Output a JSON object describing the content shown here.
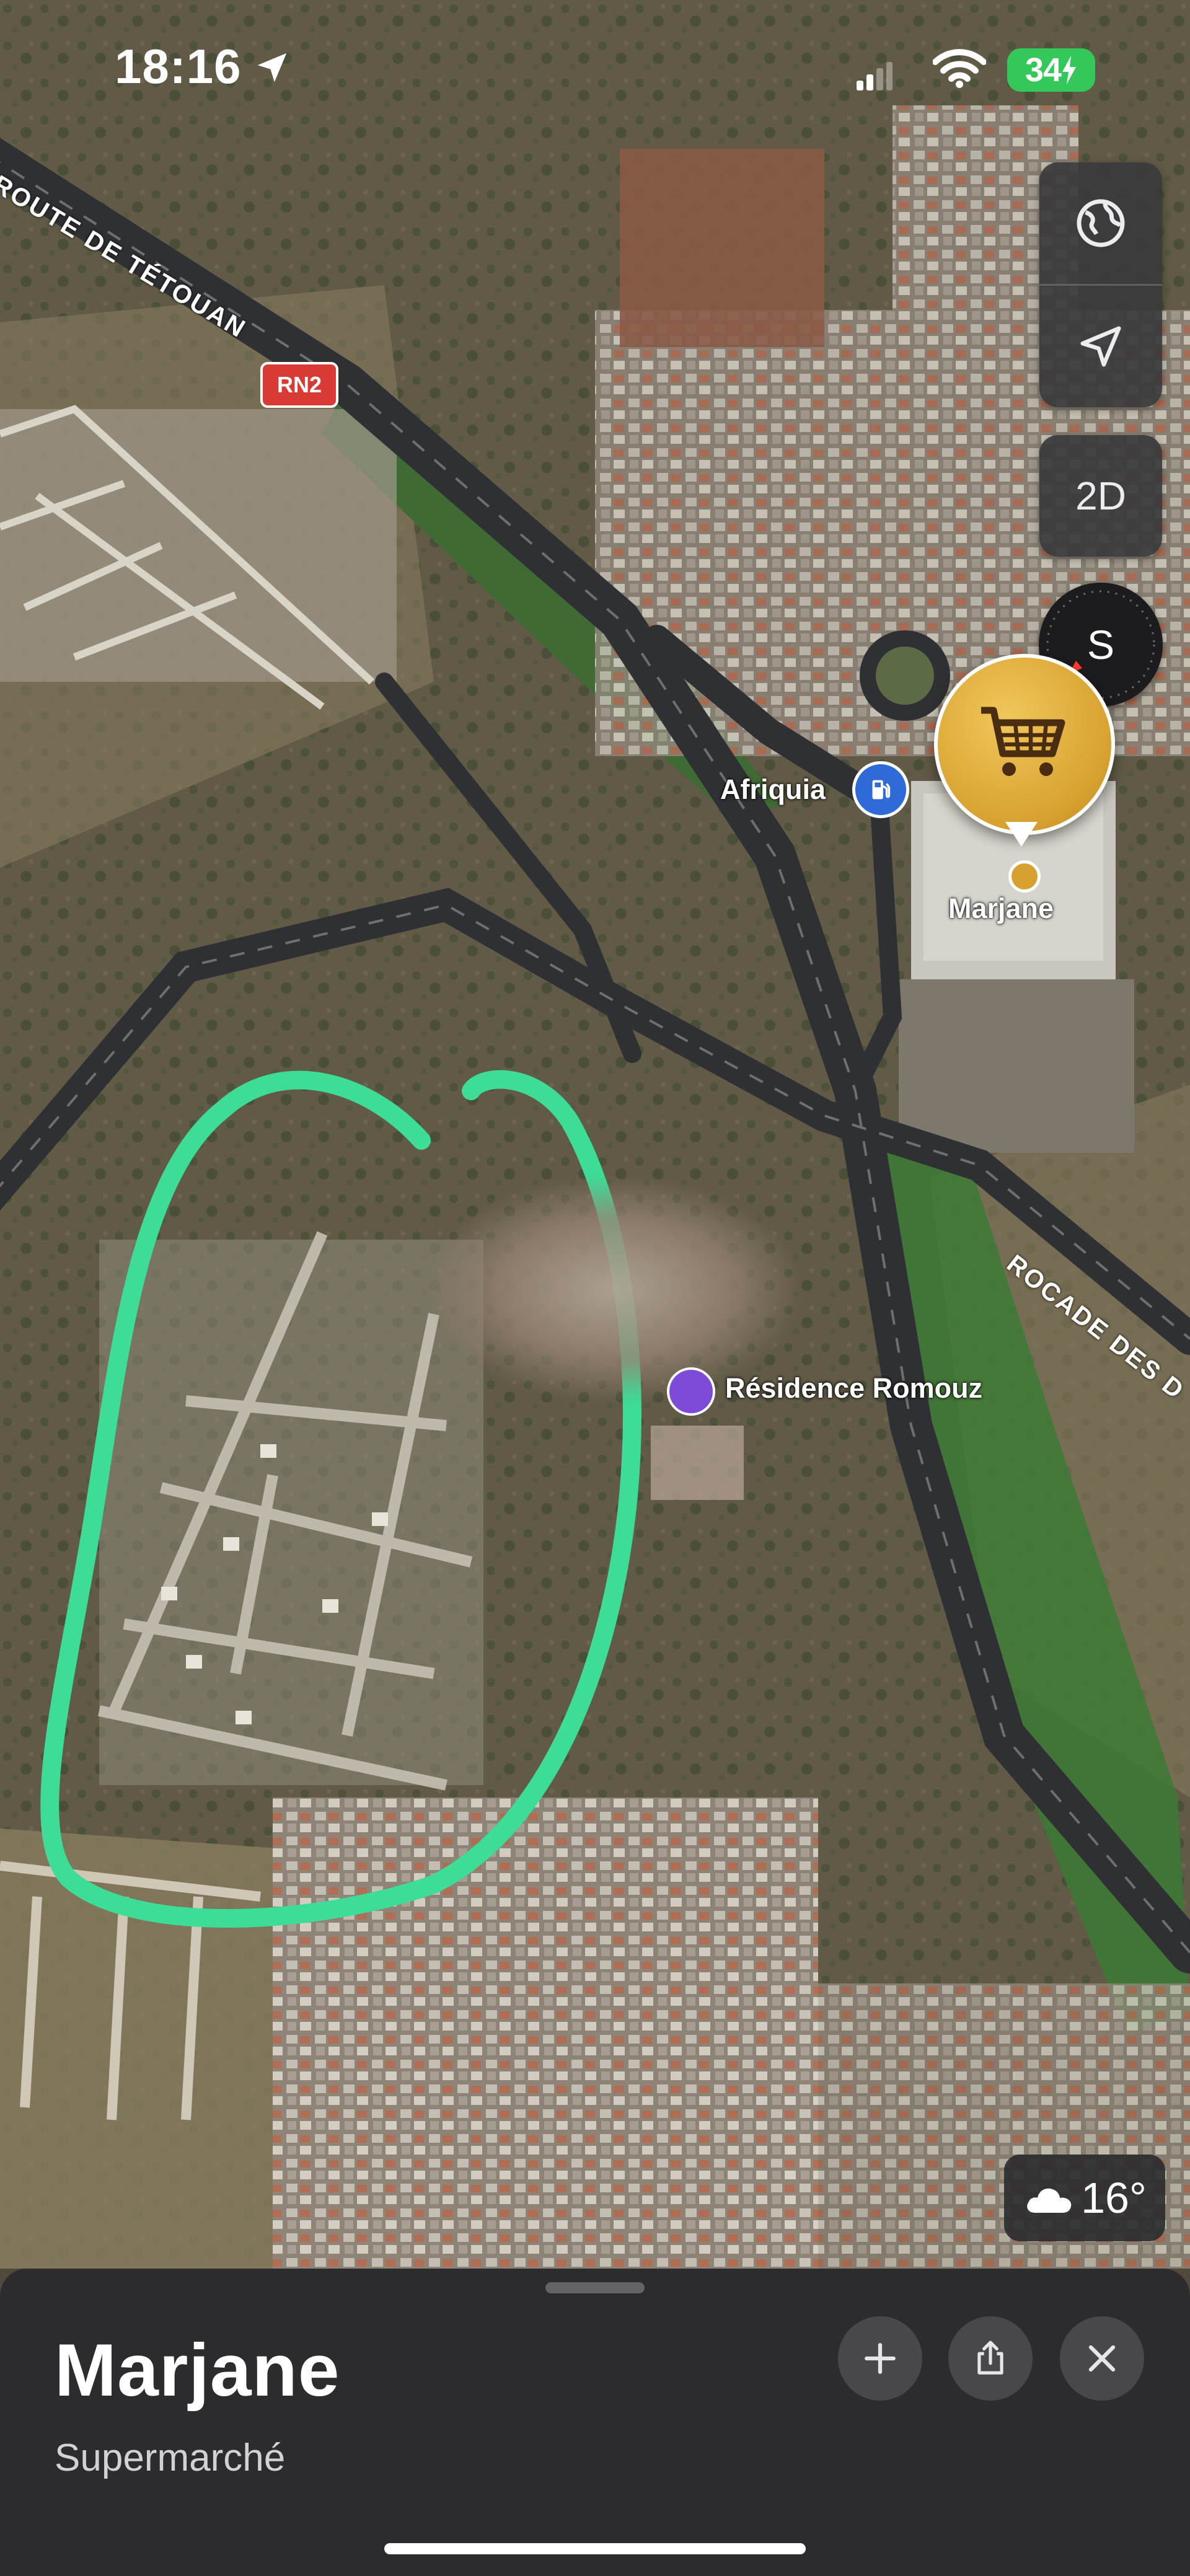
{
  "status_bar": {
    "time": "18:16",
    "battery": "34"
  },
  "map": {
    "road_labels": {
      "route_tetouan": "ROUTE DE TÉTOUAN",
      "rocade": "ROCADE DES D",
      "route_shield": "RN2"
    },
    "poi_labels": {
      "fuel": "Afriquia",
      "store": "Marjane",
      "residence": "Résidence Romouz"
    },
    "controls": {
      "globe_icon": "globe-icon",
      "location_icon": "location-arrow-icon",
      "view_mode": "2D",
      "compass": "S"
    },
    "weather": {
      "icon": "cloud-icon",
      "temperature": "16°"
    },
    "colors": {
      "highlight_loop": "#3ddc97",
      "pin_gold": "#d7a12f",
      "fuel_blue": "#2f6ad9",
      "poi_purple": "#7d4bd8",
      "road_shield": "#d93a33"
    }
  },
  "place_card": {
    "title": "Marjane",
    "subtitle": "Supermarché",
    "actions": {
      "add": "plus-icon",
      "share": "share-icon",
      "close": "close-icon"
    }
  }
}
